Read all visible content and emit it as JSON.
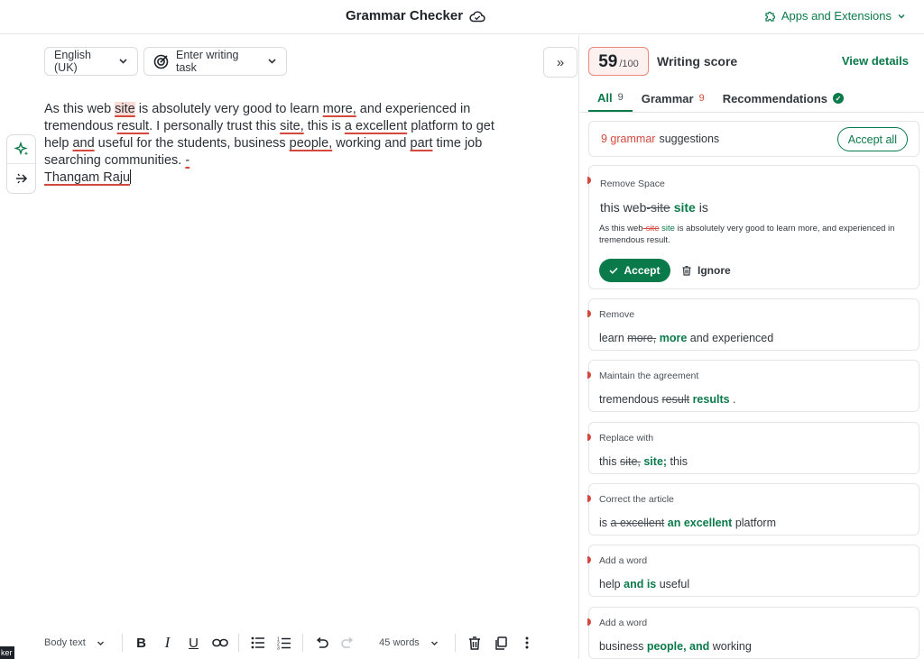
{
  "header": {
    "title": "Grammar Checker",
    "apps_link": "Apps and Extensions"
  },
  "editor": {
    "language": "English (UK)",
    "writing_task": "Enter writing task",
    "collapse_label": "»",
    "text": {
      "p1": "As this web ",
      "site": "site",
      "p2": " is absolutely very good to learn ",
      "more": "more,",
      "p3": " and experienced in tremendous ",
      "result": "result",
      "p4": ". I personally trust this ",
      "site2": "site,",
      "p5": " this is ",
      "excellent": "a excellent",
      "p6": " platform to get help ",
      "and": "and",
      "p7": " useful for the students, business ",
      "people": "people,",
      "p8": " working and ",
      "part": "part",
      "p9": " time job searching communities. ",
      "dash": "-",
      "author": "Thangam Raju"
    },
    "toolbar": {
      "style": "Body text",
      "bold": "B",
      "italic": "I",
      "underline": "U",
      "words": "45 words"
    },
    "tooltip": "ker"
  },
  "panel": {
    "score": "59",
    "score_max": "/100",
    "score_label": "Writing score",
    "view_details": "View details",
    "tabs": [
      {
        "label": "All",
        "count": "9"
      },
      {
        "label": "Grammar",
        "count": "9"
      },
      {
        "label": "Recommendations"
      }
    ],
    "summary": {
      "count": "9 grammar",
      "text": "suggestions",
      "accept_all": "Accept all"
    },
    "card1": {
      "title": "Remove Space",
      "before": "this web",
      "strike": "-site",
      "insert": "site",
      "after": "is",
      "context_a": "As this web",
      "context_strike": "-site",
      "context_ins": "site",
      "context_b": "is absolutely very good to learn more, and experienced in tremendous result.",
      "accept": "Accept",
      "ignore": "Ignore"
    },
    "cards": [
      {
        "title": "Remove",
        "before": "learn",
        "strike": "more,",
        "insert": "more",
        "after": "and experienced"
      },
      {
        "title": "Maintain the agreement",
        "before": "tremendous",
        "strike": "result",
        "insert": "results",
        "after": "."
      },
      {
        "title": "Replace with",
        "before": "this",
        "strike": "site,",
        "insert": "site;",
        "after": "this"
      },
      {
        "title": "Correct the article",
        "before": "is",
        "strike": "a excellent",
        "insert": "an excellent",
        "after": "platform"
      },
      {
        "title": "Add a word",
        "before": "help",
        "strike": "",
        "insert": "and is",
        "after": "useful"
      },
      {
        "title": "Add a word",
        "before": "business",
        "strike": "",
        "insert": "people, and",
        "after": "working"
      }
    ]
  },
  "colors": {
    "accent": "#0b7a4a",
    "error": "#d4493d",
    "score_bg": "#fdf1ef"
  }
}
